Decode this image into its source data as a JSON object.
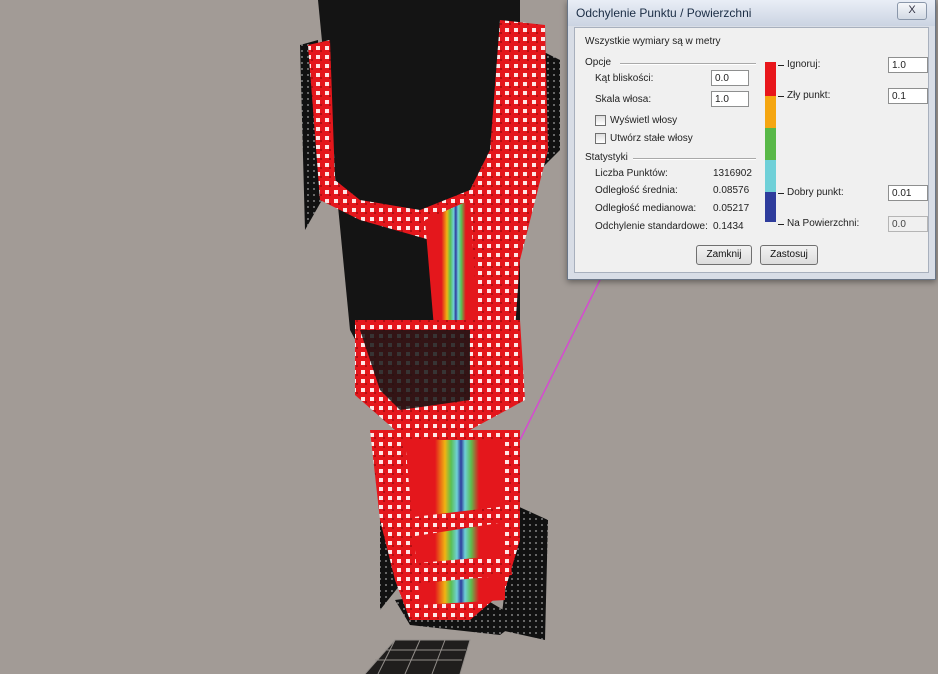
{
  "dialog": {
    "title": "Odchylenie Punktu / Powierzchni",
    "close_label": "X",
    "info": "Wszystkie wymiary są w metry",
    "options": {
      "section_label": "Opcje",
      "proximity_angle_label": "Kąt bliskości:",
      "proximity_angle_value": "0.0",
      "hair_scale_label": "Skala włosa:",
      "hair_scale_value": "1.0",
      "show_hair_label": "Wyświetl włosy",
      "show_hair_checked": false,
      "fixed_hair_label": "Utwórz stałe włosy",
      "fixed_hair_checked": false
    },
    "statistics": {
      "section_label": "Statystyki",
      "rows": [
        {
          "label": "Liczba Punktów:",
          "value": "1316902"
        },
        {
          "label": "Odległość średnia:",
          "value": "0.08576"
        },
        {
          "label": "Odległość medianowa:",
          "value": "0.05217"
        },
        {
          "label": "Odchylenie standardowe:",
          "value": "0.1434"
        }
      ]
    },
    "scale": {
      "colors": [
        "#e8161b",
        "#f5a611",
        "#58b848",
        "#6fd0d8",
        "#2e3c9c"
      ],
      "thresholds": [
        {
          "label": "Ignoruj:",
          "value": "1.0"
        },
        {
          "label": "Zły punkt:",
          "value": "0.1"
        },
        {
          "label": "Dobry punkt:",
          "value": "0.01"
        },
        {
          "label": "Na Powierzchni:",
          "value": "0.0"
        }
      ]
    },
    "buttons": {
      "close_label": "Zamknij",
      "apply_label": "Zastosuj"
    }
  }
}
